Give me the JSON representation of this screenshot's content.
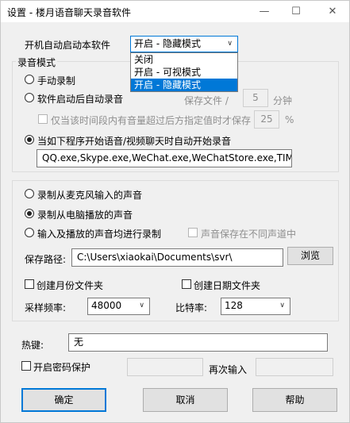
{
  "window": {
    "title": "设置 - 楼月语音聊天录音软件",
    "minimize_glyph": "—",
    "maximize_glyph": "☐",
    "close_glyph": "✕"
  },
  "startup": {
    "label": "开机自动启动本软件",
    "selected": "开启 - 隐藏模式",
    "options": [
      "关闭",
      "开启 - 可视模式",
      "开启 - 隐藏模式"
    ],
    "highlighted_index": 2
  },
  "record_mode": {
    "legend": "录音模式",
    "manual": "手动录制",
    "auto_on_start": "软件启动后自动录音",
    "save_file_label": "保存文件 /",
    "save_minutes": "5",
    "minutes_unit": "分钟",
    "threshold_label": "仅当该时间段内有音量超过后方指定值时才保存",
    "threshold_value": "25",
    "percent_unit": "%",
    "on_program_label": "当如下程序开始语音/视频聊天时自动开始录音",
    "programs": "QQ.exe,Skype.exe,WeChat.exe,WeChatStore.exe,TIM.exe",
    "selected": "on_program"
  },
  "source": {
    "mic": "录制从麦克风输入的声音",
    "playback": "录制从电脑播放的声音",
    "both": "输入及播放的声音均进行录制",
    "separate_channel": "声音保存在不同声道中",
    "selected": "playback"
  },
  "storage": {
    "path_label": "保存路径:",
    "path_value": "C:\\Users\\xiaokai\\Documents\\svr\\",
    "browse": "浏览",
    "month_folder": "创建月份文件夹",
    "date_folder": "创建日期文件夹"
  },
  "audio": {
    "sample_label": "采样频率:",
    "sample_value": "48000",
    "bitrate_label": "比特率:",
    "bitrate_value": "128"
  },
  "hotkey": {
    "label": "热键:",
    "value": "无"
  },
  "password": {
    "label": "开启密码保护",
    "reenter_label": "再次输入"
  },
  "buttons": {
    "ok": "确定",
    "cancel": "取消",
    "help": "帮助"
  },
  "colors": {
    "accent": "#0078d7",
    "window_bg": "#f0f0f0"
  }
}
